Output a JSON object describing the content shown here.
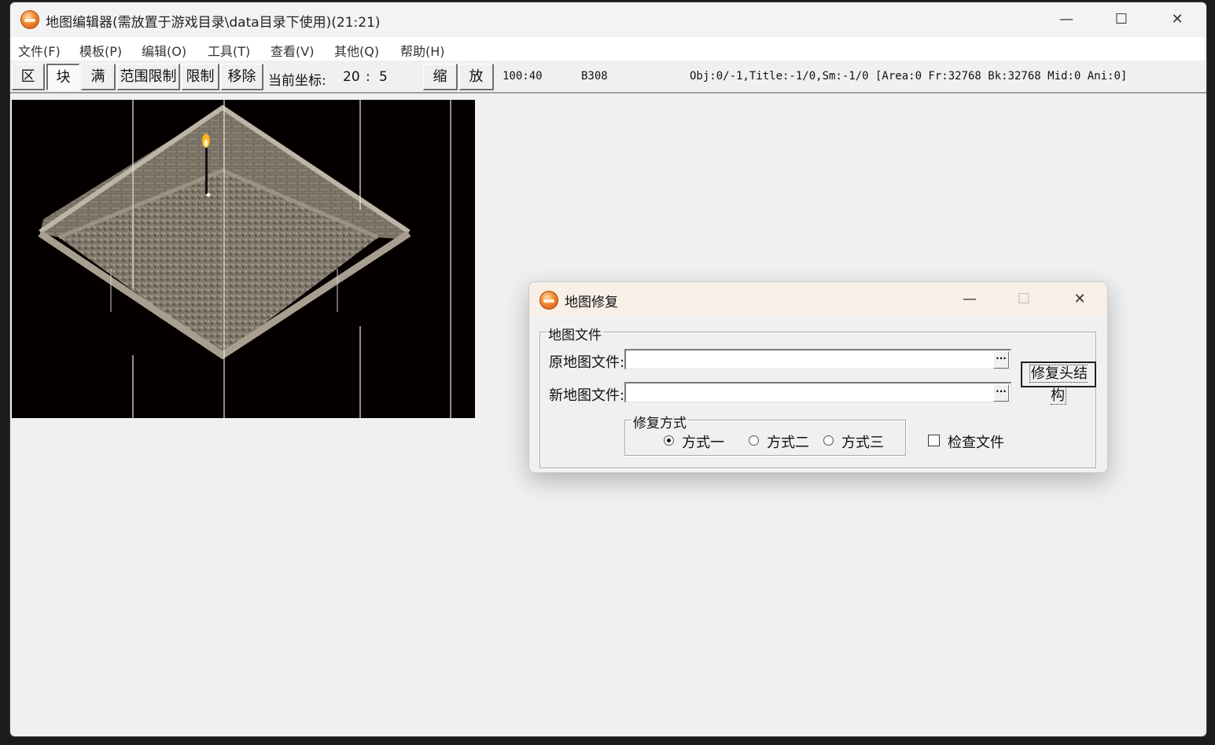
{
  "window": {
    "title": "地图编辑器(需放置于游戏目录\\data目录下使用)(21:21)",
    "controls": {
      "minimize": "—",
      "maximize": "☐",
      "close": "✕"
    }
  },
  "menu": [
    "文件(F)",
    "模板(P)",
    "编辑(O)",
    "工具(T)",
    "查看(V)",
    "其他(Q)",
    "帮助(H)"
  ],
  "toolbar": {
    "buttons": [
      "区",
      "块",
      "满",
      "范围限制",
      "限制",
      "移除"
    ],
    "coord_label": "当前坐标:",
    "coord_x": "20",
    "coord_sep": ":",
    "coord_y": "5",
    "zoom_out": "缩",
    "zoom_in": "放",
    "map_size": "100:40",
    "map_code": "B308",
    "status": "Obj:0/-1,Title:-1/0,Sm:-1/0 [Area:0 Fr:32768 Bk:32768 Mid:0 Ani:0]"
  },
  "dialog": {
    "title": "地图修复",
    "controls": {
      "minimize": "—",
      "maximize": "☐",
      "close": "✕"
    },
    "file_group": "地图文件",
    "source_label": "原地图文件:",
    "source_value": "",
    "target_label": "新地图文件:",
    "target_value": "",
    "browse": "···",
    "fix_button": "修复头结构",
    "method_group": "修复方式",
    "methods": [
      "方式一",
      "方式二",
      "方式三"
    ],
    "selected_method": "方式一",
    "check_label": "检查文件",
    "check_checked": false
  }
}
